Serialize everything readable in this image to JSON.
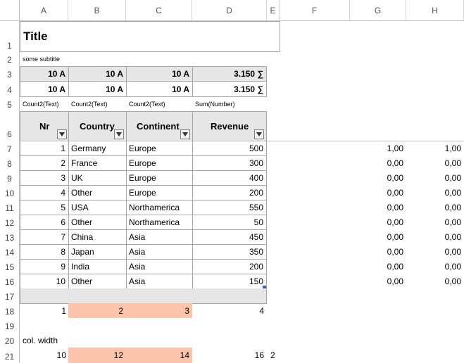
{
  "columns": [
    "A",
    "B",
    "C",
    "D",
    "E",
    "F",
    "G",
    "H"
  ],
  "rows": [
    "1",
    "2",
    "3",
    "4",
    "5",
    "6",
    "7",
    "8",
    "9",
    "10",
    "11",
    "12",
    "13",
    "14",
    "15",
    "16",
    "17",
    "18",
    "19",
    "20",
    "21"
  ],
  "title": "Title",
  "subtitle": "some subtitle",
  "summary_rows": [
    [
      "10 A",
      "10 A",
      "10 A",
      "3.150 ∑"
    ],
    [
      "10 A",
      "10 A",
      "10 A",
      "3.150 ∑"
    ]
  ],
  "aggregates": [
    "Count2(Text)",
    "Count2(Text)",
    "Count2(Text)",
    "Sum(Number)"
  ],
  "table": {
    "headers": [
      "Nr",
      "Country",
      "Continent",
      "Revenue"
    ],
    "rows": [
      [
        "1",
        "Germany",
        "Europe",
        "500"
      ],
      [
        "2",
        "France",
        "Europe",
        "300"
      ],
      [
        "3",
        "UK",
        "Europe",
        "400"
      ],
      [
        "4",
        "Other",
        "Europe",
        "200"
      ],
      [
        "5",
        "USA",
        "Northamerica",
        "550"
      ],
      [
        "6",
        "Other",
        "Northamerica",
        "50"
      ],
      [
        "7",
        "China",
        "Asia",
        "450"
      ],
      [
        "8",
        "Japan",
        "Asia",
        "350"
      ],
      [
        "9",
        "India",
        "Asia",
        "200"
      ],
      [
        "10",
        "Other",
        "Asia",
        "150"
      ]
    ]
  },
  "side_values": [
    [
      "1,00",
      "1,00"
    ],
    [
      "0,00",
      "0,00"
    ],
    [
      "0,00",
      "0,00"
    ],
    [
      "0,00",
      "0,00"
    ],
    [
      "0,00",
      "0,00"
    ],
    [
      "0,00",
      "0,00"
    ],
    [
      "0,00",
      "0,00"
    ],
    [
      "0,00",
      "0,00"
    ],
    [
      "0,00",
      "0,00"
    ],
    [
      "0,00",
      "0,00"
    ]
  ],
  "col_index_row": [
    "1",
    "2",
    "3",
    "4"
  ],
  "col_width_label": "col. width",
  "col_width_row": [
    "10",
    "12",
    "14",
    "16",
    "2"
  ],
  "colors": {
    "highlight": "#fbc4ab",
    "header_grey": "#e6e6e6"
  }
}
